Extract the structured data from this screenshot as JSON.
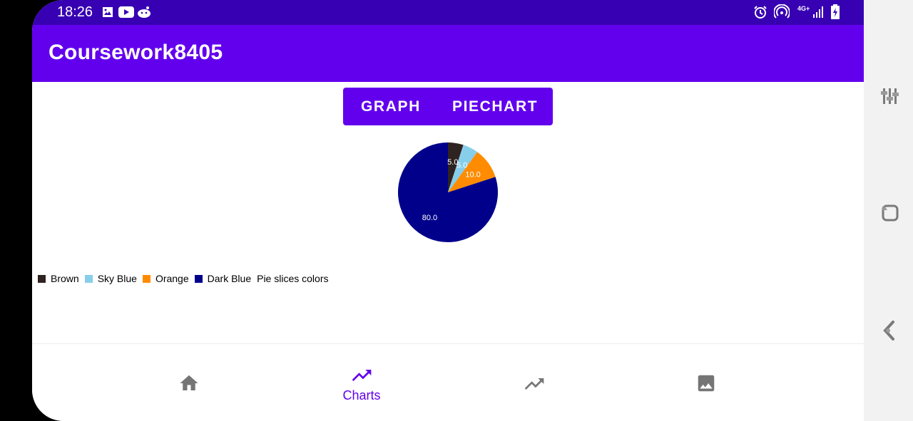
{
  "status_bar": {
    "time": "18:26",
    "left_icons": [
      "image-icon",
      "youtube-icon",
      "reddit-icon"
    ],
    "right_icons": [
      "alarm-icon",
      "hotspot-icon",
      "network-4g-icon",
      "signal-icon",
      "battery-charging-icon"
    ],
    "network_label": "4G+"
  },
  "app_bar": {
    "title": "Coursework8405"
  },
  "toggle": {
    "graph_label": "GRAPH",
    "piechart_label": "PIECHART"
  },
  "chart_data": {
    "type": "pie",
    "title": "",
    "slices": [
      {
        "label": "Brown",
        "value": 5.0,
        "value_label": "5.0",
        "color": "#2E2320"
      },
      {
        "label": "Sky Blue",
        "value": 5.0,
        "value_label": "5.0",
        "color": "#87CEEB"
      },
      {
        "label": "Orange",
        "value": 10.0,
        "value_label": "10.0",
        "color": "#FF8C00"
      },
      {
        "label": "Dark Blue",
        "value": 80.0,
        "value_label": "80.0",
        "color": "#00008B"
      }
    ],
    "legend_description": "Pie slices colors",
    "legend_position": "bottom-left"
  },
  "bottom_nav": {
    "items": [
      {
        "icon": "home-icon",
        "label": "",
        "selected": false
      },
      {
        "icon": "trending-up-icon",
        "label": "Charts",
        "selected": true
      },
      {
        "icon": "trending-up-icon",
        "label": "",
        "selected": false
      },
      {
        "icon": "image-icon",
        "label": "",
        "selected": false
      }
    ]
  },
  "colors": {
    "status_bar": "#3700B3",
    "primary": "#6200EE",
    "nav_inactive": "#757575"
  },
  "side_panel": {
    "icons": [
      "sliders-icon",
      "rotate-icon",
      "pin-icon"
    ]
  }
}
